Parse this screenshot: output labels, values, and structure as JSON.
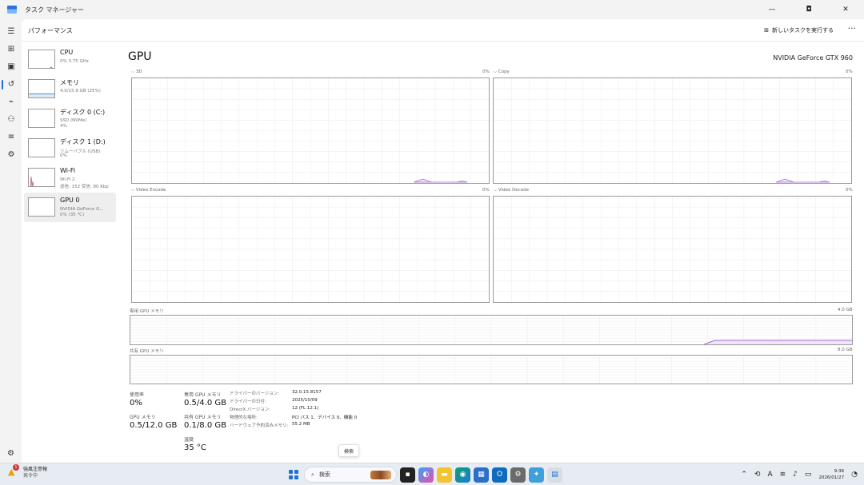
{
  "window": {
    "title": "タスク マネージャー",
    "controls": [
      "—",
      "◘",
      "✕"
    ]
  },
  "header": {
    "section": "パフォーマンス",
    "run_task": "新しいタスクを実行する",
    "more": "···"
  },
  "devices": [
    {
      "name": "CPU",
      "sub1": "0% 3.75 GHz",
      "sub2": ""
    },
    {
      "name": "メモリ",
      "sub1": "4.0/15.9 GB (25%)",
      "sub2": ""
    },
    {
      "name": "ディスク 0 (C:)",
      "sub1": "SSD (NVMe)",
      "sub2": "4%"
    },
    {
      "name": "ディスク 1 (D:)",
      "sub1": "リムーバブル (USB)",
      "sub2": "0%"
    },
    {
      "name": "Wi-Fi",
      "sub1": "Wi-Fi 2",
      "sub2": "送信: 152 受信: 80 Kbp"
    },
    {
      "name": "GPU 0",
      "sub1": "NVIDIA GeForce G...",
      "sub2": "0% (35 °C)"
    }
  ],
  "gpu": {
    "title": "GPU",
    "model": "NVIDIA GeForce GTX 960",
    "engines": [
      {
        "label": "⌵ 3D",
        "pct": "0%"
      },
      {
        "label": "⌵ Copy",
        "pct": "0%"
      },
      {
        "label": "⌵ Video Encode",
        "pct": "0%"
      },
      {
        "label": "⌵ Video Decode",
        "pct": "0%"
      }
    ],
    "dedicated_mem_label": "専用 GPU メモリ",
    "dedicated_mem_max": "4.0 GB",
    "shared_mem_label": "共有 GPU メモリ",
    "shared_mem_max": "8.0 GB",
    "stats": {
      "usage_label": "使用率",
      "usage": "0%",
      "gpu_mem_label": "GPU メモリ",
      "gpu_mem": "0.5/12.0 GB",
      "ded_label": "専用 GPU メモリ",
      "ded": "0.5/4.0 GB",
      "shared_label": "共有 GPU メモリ",
      "shared": "0.1/8.0 GB",
      "temp_label": "温度",
      "temp": "35 °C"
    },
    "details": [
      {
        "key": "ドライバーのバージョン:",
        "value": "32.0.15.8157"
      },
      {
        "key": "ドライバーの日付:",
        "value": "2025/10/09"
      },
      {
        "key": "DirectX バージョン:",
        "value": "12 (FL 12.1)"
      },
      {
        "key": "物理的な場所:",
        "value": "PCI バス 1、デバイス 0、機能 0"
      },
      {
        "key": "ハードウェア予約済みメモリ:",
        "value": "55.2 MB"
      }
    ]
  },
  "tooltip": "検索",
  "taskbar": {
    "weather_badge": "1",
    "weather_line1": "強風注意報",
    "weather_line2": "発令中",
    "search_placeholder": "検索",
    "time": "9:36",
    "date": "2026/01/27"
  },
  "colors": {
    "accent": "#1f6fd1",
    "gpu_line": "#a46bd4",
    "gpu_fill": "#efe4fa"
  }
}
